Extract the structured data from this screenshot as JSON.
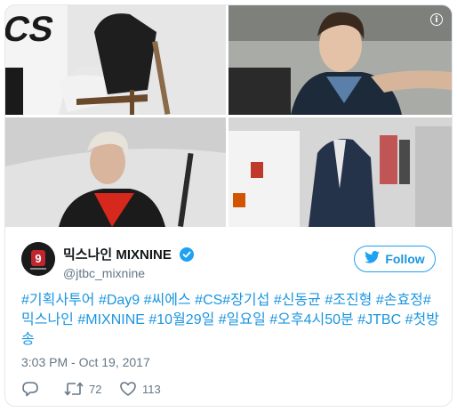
{
  "media": {
    "photos": [
      {
        "name": "photo-1"
      },
      {
        "name": "photo-2"
      },
      {
        "name": "photo-3"
      },
      {
        "name": "photo-4"
      }
    ],
    "info_icon": "info-icon"
  },
  "user": {
    "display_name": "믹스나인 MIXNINE",
    "handle": "@jtbc_mixnine",
    "verified": true,
    "avatar_icon": "avatar"
  },
  "follow_button": {
    "label": "Follow",
    "icon": "twitter-bird-icon"
  },
  "tweet": {
    "hashtags": [
      "#기획사투어",
      "#Day9",
      "#씨에스",
      "#CS",
      "#장기섭",
      "#신동균",
      "#조진형",
      "#손효정",
      "#믹스나인",
      "#MIXNINE",
      "#10월29일",
      "#일요일",
      "#오후4시50분",
      "#JTBC",
      "#첫방송"
    ],
    "timestamp": "3:03 PM - Oct 19, 2017"
  },
  "actions": {
    "reply": {
      "icon": "reply-icon"
    },
    "retweet": {
      "icon": "retweet-icon",
      "count": "72"
    },
    "like": {
      "icon": "heart-icon",
      "count": "113"
    }
  },
  "colors": {
    "link": "#1b95e0",
    "muted": "#657786",
    "verified_badge": "#1da1f2",
    "border": "#e1e8ed"
  }
}
